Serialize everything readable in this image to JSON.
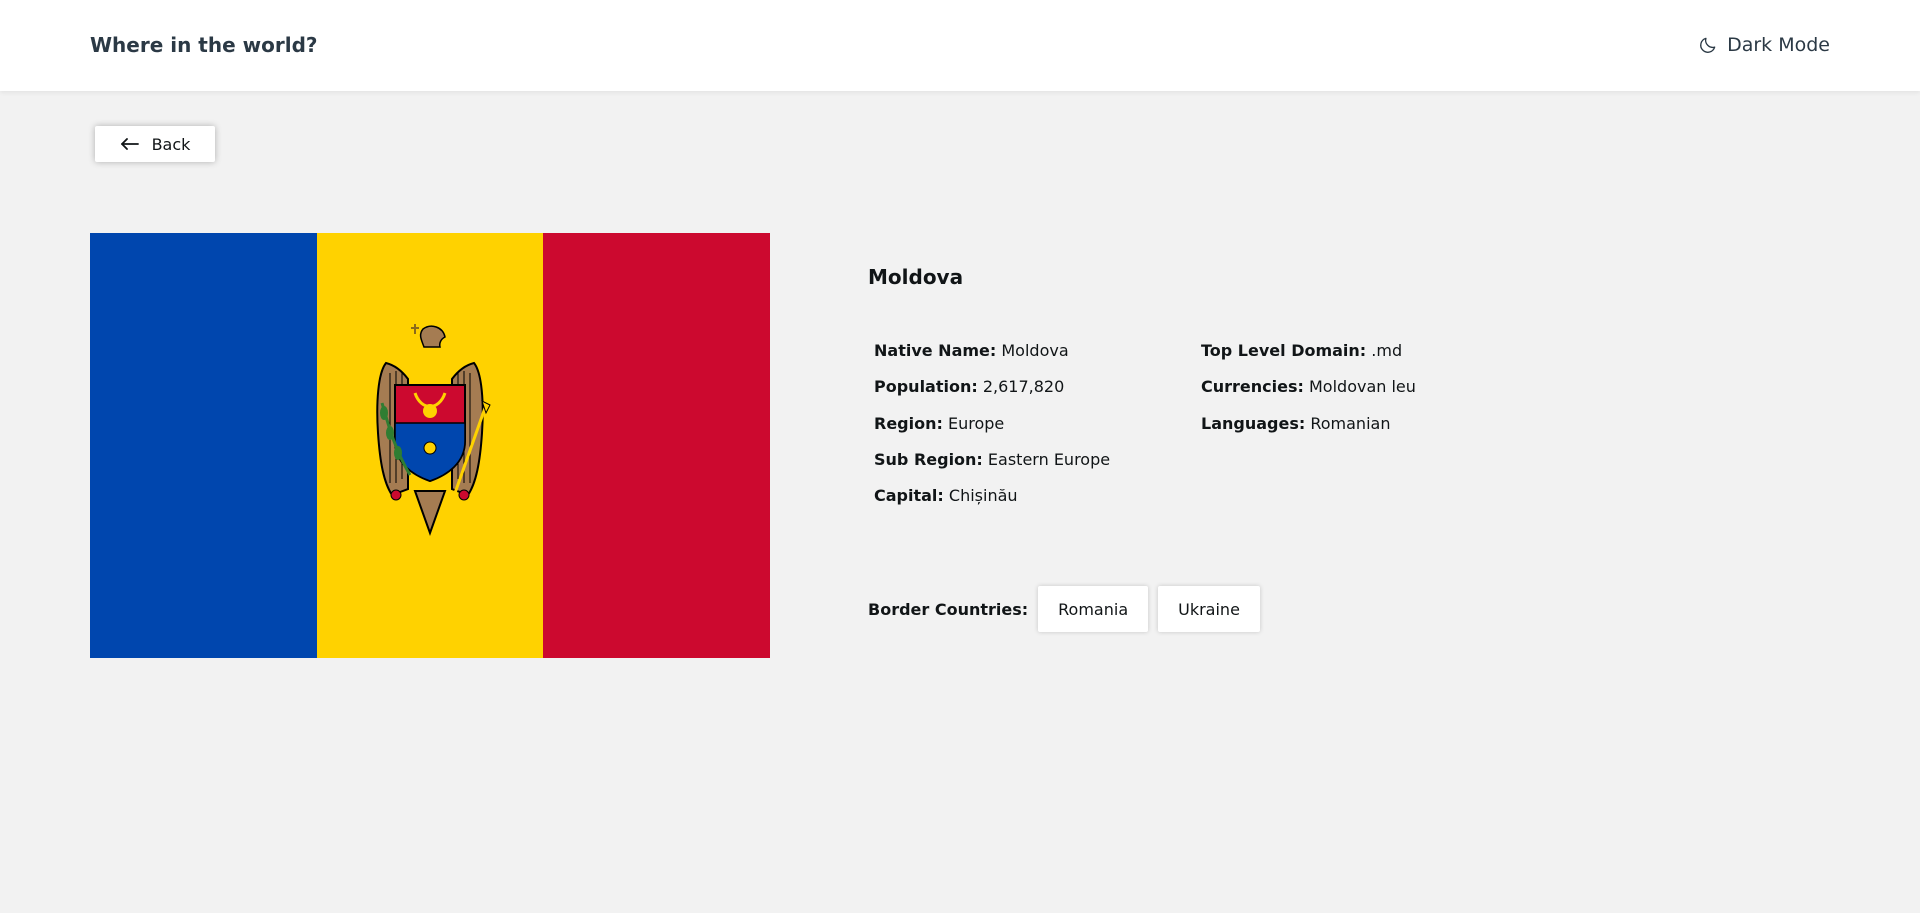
{
  "header": {
    "title": "Where in the world?",
    "mode_icon": "moon-icon",
    "mode_label": "Dark Mode"
  },
  "back_button": {
    "icon": "arrow-left-icon",
    "label": "Back"
  },
  "flag": {
    "description_icon": "moldova-flag",
    "colors": {
      "blue": "#0046ae",
      "yellow": "#ffd200",
      "red": "#cc092f"
    }
  },
  "country": {
    "name": "Moldova",
    "left_details": [
      {
        "label": "Native Name:",
        "value": "Moldova"
      },
      {
        "label": "Population:",
        "value": "2,617,820"
      },
      {
        "label": "Region:",
        "value": "Europe"
      },
      {
        "label": "Sub Region:",
        "value": "Eastern Europe"
      },
      {
        "label": "Capital:",
        "value": "Chișinău"
      }
    ],
    "right_details": [
      {
        "label": "Top Level Domain:",
        "value": ".md"
      },
      {
        "label": "Currencies:",
        "value": "Moldovan leu"
      },
      {
        "label": "Languages:",
        "value": "Romanian"
      }
    ],
    "border_label": "Border Countries:",
    "borders": [
      "Romania",
      "Ukraine"
    ]
  }
}
